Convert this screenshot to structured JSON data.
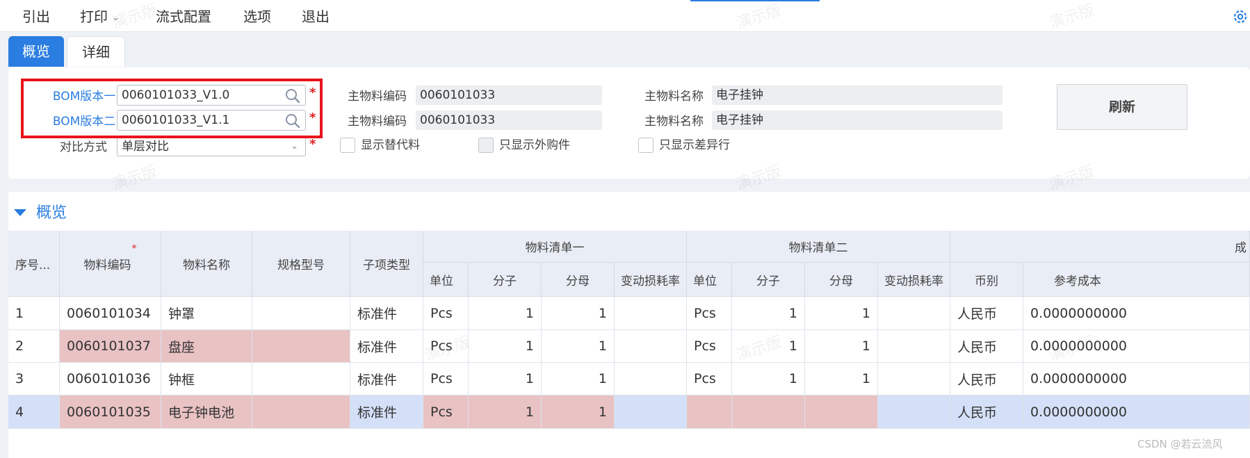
{
  "menu": {
    "items": [
      {
        "label": "引出"
      },
      {
        "label": "打印",
        "dropdown": true
      },
      {
        "label": "流式配置"
      },
      {
        "label": "选项"
      },
      {
        "label": "退出"
      }
    ]
  },
  "tabs": {
    "overview": "概览",
    "detail": "详细"
  },
  "form": {
    "bom1_label": "BOM版本一:",
    "bom1_value": "0060101033_V1.0",
    "bom2_label": "BOM版本二:",
    "bom2_value": "0060101033_V1.1",
    "compare_label": "对比方式",
    "compare_value": "单层对比",
    "main_code_label": "主物料编码",
    "main_code_1": "0060101033",
    "main_code_2": "0060101033",
    "main_name_label": "主物料名称",
    "main_name_1": "电子挂钟",
    "main_name_2": "电子挂钟",
    "chk_substitute": "显示替代料",
    "chk_purchased": "只显示外购件",
    "chk_diff": "只显示差异行",
    "required_mark": "*",
    "refresh": "刷新"
  },
  "section": {
    "title": "概览"
  },
  "table": {
    "headers": {
      "seq": "序号...",
      "code": "物料编码",
      "name": "物料名称",
      "spec": "规格型号",
      "type": "子项类型",
      "group1": "物料清单一",
      "group2": "物料清单二",
      "group3": "成",
      "unit": "单位",
      "numerator": "分子",
      "denominator": "分母",
      "loss": "变动损耗率",
      "currency": "币别",
      "cost": "参考成本"
    },
    "rows": [
      {
        "seq": "1",
        "code": "0060101034",
        "name": "钟罩",
        "spec": "",
        "type": "标准件",
        "unit1": "Pcs",
        "num1": "1",
        "den1": "1",
        "loss1": "",
        "unit2": "Pcs",
        "num2": "1",
        "den2": "1",
        "loss2": "",
        "currency": "人民币",
        "cost": "0.0000000000"
      },
      {
        "seq": "2",
        "code": "0060101037",
        "name": "盘座",
        "spec": "",
        "type": "标准件",
        "unit1": "Pcs",
        "num1": "1",
        "den1": "1",
        "loss1": "",
        "unit2": "Pcs",
        "num2": "1",
        "den2": "1",
        "loss2": "",
        "currency": "人民币",
        "cost": "0.0000000000"
      },
      {
        "seq": "3",
        "code": "0060101036",
        "name": "钟框",
        "spec": "",
        "type": "标准件",
        "unit1": "Pcs",
        "num1": "1",
        "den1": "1",
        "loss1": "",
        "unit2": "Pcs",
        "num2": "1",
        "den2": "1",
        "loss2": "",
        "currency": "人民币",
        "cost": "0.0000000000"
      },
      {
        "seq": "4",
        "code": "0060101035",
        "name": "电子钟电池",
        "spec": "",
        "type": "标准件",
        "unit1": "Pcs",
        "num1": "1",
        "den1": "1",
        "loss1": "",
        "unit2": "",
        "num2": "",
        "den2": "",
        "loss2": "",
        "currency": "人民币",
        "cost": "0.0000000000"
      }
    ]
  },
  "watermark": "演示版",
  "footer": "CSDN @若云流风",
  "colors": {
    "accent": "#2a7de1",
    "diff_highlight": "#e9c2c4",
    "selected_row": "#d4e0f7",
    "required": "#e02020",
    "annotation_box": "#e8141c"
  }
}
